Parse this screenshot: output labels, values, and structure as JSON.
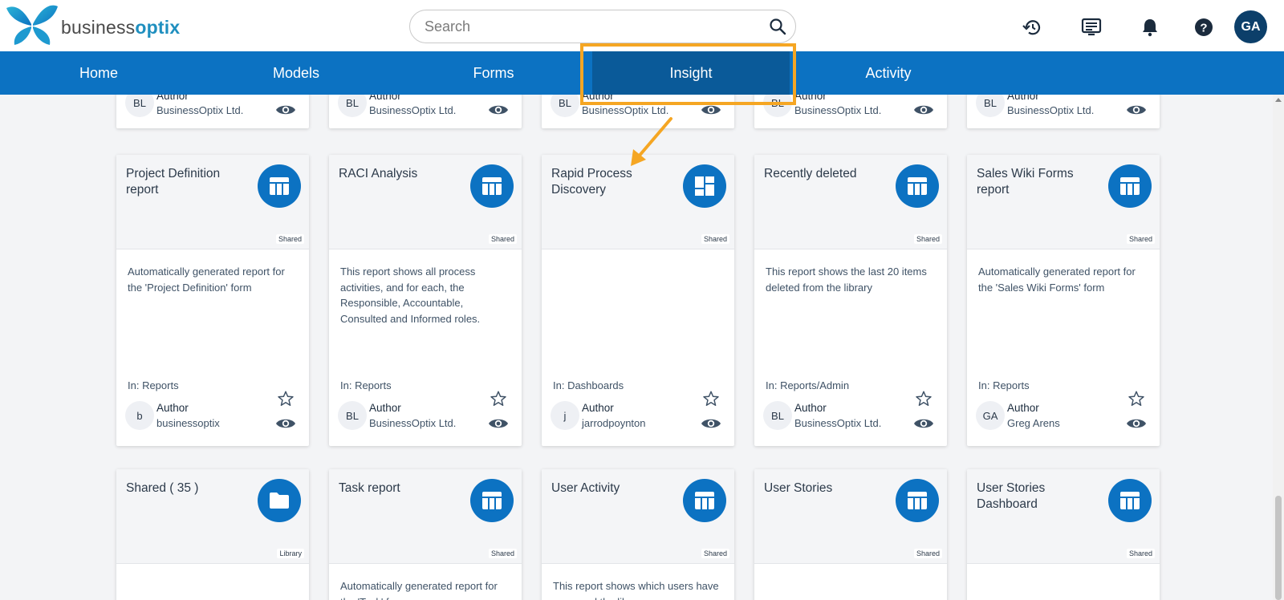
{
  "app": {
    "logo_text_a": "business",
    "logo_text_b": "optix"
  },
  "search": {
    "placeholder": "Search"
  },
  "toolbar": {
    "avatar_initials": "GA"
  },
  "nav": {
    "items": [
      {
        "label": "Home"
      },
      {
        "label": "Models"
      },
      {
        "label": "Forms"
      },
      {
        "label": "Insight"
      },
      {
        "label": "Activity"
      }
    ]
  },
  "top_row": [
    {
      "initials": "BL",
      "author_label": "Author",
      "author": "BusinessOptix Ltd."
    },
    {
      "initials": "BL",
      "author_label": "Author",
      "author": "BusinessOptix Ltd."
    },
    {
      "initials": "BL",
      "author_label": "Author",
      "author": "BusinessOptix Ltd."
    },
    {
      "initials": "BL",
      "author_label": "Author",
      "author": "BusinessOptix Ltd."
    },
    {
      "initials": "BL",
      "author_label": "Author",
      "author": "BusinessOptix Ltd."
    }
  ],
  "middle_row": [
    {
      "title": "Project Definition report",
      "icon": "table-icon",
      "tag": "Shared",
      "description": "Automatically generated report for the 'Project Definition' form",
      "location": "In: Reports",
      "initials": "b",
      "author_label": "Author",
      "author": "businessoptix"
    },
    {
      "title": "RACI Analysis",
      "icon": "table-icon",
      "tag": "Shared",
      "description": "This report shows all process activities, and for each, the Responsible, Accountable, Consulted and Informed roles.",
      "location": "In: Reports",
      "initials": "BL",
      "author_label": "Author",
      "author": "BusinessOptix Ltd."
    },
    {
      "title": "Rapid Process Discovery",
      "icon": "dashboard-icon",
      "tag": "Shared",
      "description": "",
      "location": "In: Dashboards",
      "initials": "j",
      "author_label": "Author",
      "author": "jarrodpoynton"
    },
    {
      "title": "Recently deleted",
      "icon": "table-icon",
      "tag": "Shared",
      "description": "This report shows the last 20 items deleted from the library",
      "location": "In: Reports/Admin",
      "initials": "BL",
      "author_label": "Author",
      "author": "BusinessOptix Ltd."
    },
    {
      "title": "Sales Wiki Forms report",
      "icon": "table-icon",
      "tag": "Shared",
      "description": "Automatically generated report for the 'Sales Wiki Forms' form",
      "location": "In: Reports",
      "initials": "GA",
      "author_label": "Author",
      "author": "Greg Arens"
    }
  ],
  "bottom_row": [
    {
      "title": "Shared ( 35 )",
      "icon": "folder-icon",
      "tag": "Library",
      "description": ""
    },
    {
      "title": "Task report",
      "icon": "table-icon",
      "tag": "Shared",
      "description": "Automatically generated report for the 'Task' form"
    },
    {
      "title": "User Activity",
      "icon": "table-icon",
      "tag": "Shared",
      "description": "This report shows which users have accessed the library"
    },
    {
      "title": "User Stories",
      "icon": "table-icon",
      "tag": "Shared",
      "description": ""
    },
    {
      "title": "User Stories Dashboard",
      "icon": "table-icon",
      "tag": "Shared",
      "description": ""
    }
  ],
  "colors": {
    "nav": "#0c72c2",
    "nav_active": "#0a5a99",
    "accent": "#0c72c2",
    "highlight": "#f5a623",
    "avatar": "#0c3f6a"
  }
}
